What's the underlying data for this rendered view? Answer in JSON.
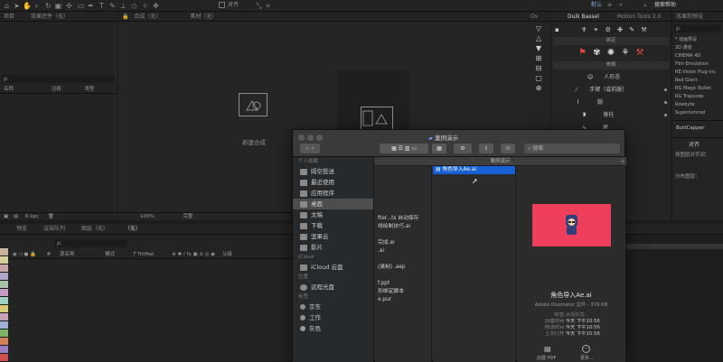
{
  "top": {
    "default_label": "默认",
    "search_placeholder": "搜索帮助",
    "align_label": "对齐"
  },
  "left_panel": {
    "tab_project": "项目",
    "tab_effect_controls": "效果控件（无）",
    "col_name": "名称",
    "col_comment": "注释",
    "col_type": "类型",
    "search_glyph": "ρ.",
    "bpc": "8 bpc"
  },
  "comp_panel": {
    "tab_comp": "合成（无）",
    "tab_footage": "素材（无）",
    "new_comp": "新建合成",
    "zoom": "100%",
    "res": "完整"
  },
  "timeline": {
    "tab_render": "预览",
    "tab_render_queue": "渲染队列",
    "tab_layers": "图层（无）",
    "tab_none": "（无）",
    "col_source": "源名称",
    "col_mode": "模式",
    "col_trk": "T TrkMat",
    "col_parent": "父级",
    "search_glyph": "ρ.",
    "label_colors": [
      "#c7b39a",
      "#d4d09a",
      "#c7a7a7",
      "#b0a6c9",
      "#a8c4a6",
      "#c69bc6",
      "#9ed0c6",
      "#d8c878",
      "#c8a0b8",
      "#9fb0d2",
      "#7db466",
      "#d2825a",
      "#9a7dc2",
      "#d24f4f"
    ]
  },
  "duik": {
    "tab": "Duik Bassel",
    "tab2": "Motion Tools 2.0",
    "section_bind": "绑定",
    "section_rig": "骨骼",
    "rows": [
      "人形态",
      "手臂（或前腿）",
      "腿",
      "脊柱",
      "尾"
    ]
  },
  "effects_panel": {
    "tab": "效果和预设",
    "search_placeholder": "ρ.",
    "items": [
      "* 动画预设",
      "3D 通道",
      "CINEMA 4D",
      "Film Emulation",
      "RE:Vision Plug-ins",
      "Red Giant",
      "RG Magic Bullet",
      "RG Trapcode",
      "Rowbyte",
      "Superluminal"
    ],
    "buttcapper": "ButtCapper",
    "align_tab": "对齐",
    "align_to": "将图层对齐到：",
    "distribute": "分布图层："
  },
  "finder": {
    "title": "案例演示",
    "path_label": "案例演示",
    "search_placeholder": "搜索",
    "sidebar": {
      "favorites_title": "个人收藏",
      "favorites": [
        {
          "label": "隔空投送",
          "icon": "airdrop-icon"
        },
        {
          "label": "最近使用",
          "icon": "clock-icon"
        },
        {
          "label": "应用程序",
          "icon": "apps-icon"
        },
        {
          "label": "桌面",
          "icon": "desktop-icon"
        },
        {
          "label": "文稿",
          "icon": "doc-icon"
        },
        {
          "label": "下载",
          "icon": "download-icon"
        },
        {
          "label": "坚果云",
          "icon": "folder-icon"
        },
        {
          "label": "影片",
          "icon": "movie-icon"
        }
      ],
      "icloud_title": "iCloud",
      "icloud_item": "iCloud 云盘",
      "locations_title": "位置",
      "locations_item": "远程光盘",
      "tags_title": "标签",
      "tags": [
        {
          "label": "京东",
          "color": "#8e8e8e"
        },
        {
          "label": "工作",
          "color": "#8e8e8e"
        },
        {
          "label": "灰色",
          "color": "#9a9a9a"
        }
      ]
    },
    "col1_items": [
      "",
      "",
      "",
      "",
      "",
      "",
      "fter...ts 自动保存",
      "线绘制技巧.ai",
      "",
      "完成.ai",
      ".ai",
      "",
      "(录制) .aep",
      "",
      "f.ppt",
      "形绑定脚本",
      "e.pur"
    ],
    "col2_items": [
      "角色导入Ae.ai"
    ],
    "preview": {
      "filename": "角色导入Ae.ai",
      "kind": "Adobe Illustrator 文件 - 379 KB",
      "tags_label": "标签",
      "tags_value": "添加标签...",
      "created_label": "创建时间",
      "created_value": "今天 下午10:56",
      "modified_label": "修改时间",
      "modified_value": "今天 下午10:56",
      "lastopen_label": "上次打开",
      "lastopen_value": "今天 下午10:56",
      "btn_pdf": "创建 PDF",
      "btn_more": "更多..."
    }
  }
}
